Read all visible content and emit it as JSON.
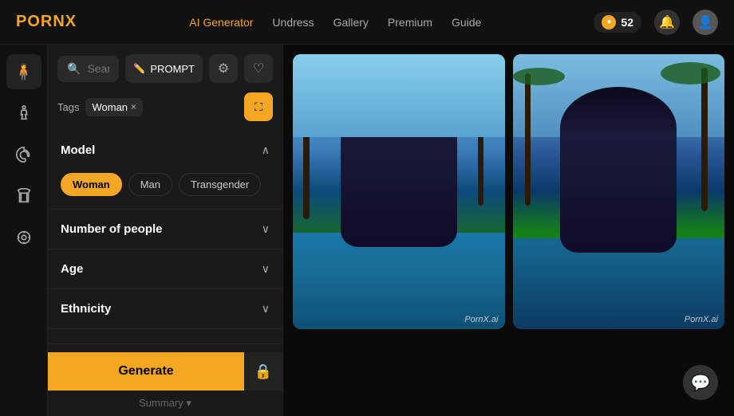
{
  "header": {
    "logo_prefix": "PORN",
    "logo_suffix": "X",
    "nav_items": [
      {
        "label": "AI Generator",
        "active": true
      },
      {
        "label": "Undress",
        "active": false
      },
      {
        "label": "Gallery",
        "active": false
      },
      {
        "label": "Premium",
        "active": false
      },
      {
        "label": "Guide",
        "active": false
      }
    ],
    "coins": "52",
    "bell_icon": "🔔",
    "user_icon": "👤"
  },
  "sidebar_icons": [
    {
      "icon": "🧍",
      "name": "model-icon",
      "active": true
    },
    {
      "icon": "🕺",
      "name": "pose-icon",
      "active": false
    },
    {
      "icon": "🎭",
      "name": "style-icon",
      "active": false
    },
    {
      "icon": "📦",
      "name": "outfit-icon",
      "active": false
    },
    {
      "icon": "⚙️",
      "name": "settings-icon",
      "active": false
    }
  ],
  "search": {
    "placeholder": "Search tags",
    "prompt_label": "PROMPT",
    "settings_icon": "⚙",
    "heart_icon": "♡"
  },
  "tags": {
    "label": "Tags",
    "active_tags": [
      {
        "text": "Woman",
        "removable": true
      }
    ],
    "expand_icon": "⛶"
  },
  "filters": {
    "model": {
      "title": "Model",
      "options": [
        {
          "label": "Woman",
          "selected": true
        },
        {
          "label": "Man",
          "selected": false
        },
        {
          "label": "Transgender",
          "selected": false
        }
      ]
    },
    "number_of_people": {
      "title": "Number of people",
      "options": []
    },
    "age": {
      "title": "Age",
      "options": []
    },
    "ethnicity": {
      "title": "Ethnicity",
      "options": []
    }
  },
  "generate": {
    "button_label": "Generate",
    "lock_icon": "🔒",
    "summary_label": "Summary ▾"
  },
  "images": [
    {
      "id": 1,
      "watermark": "PornX.ai",
      "scene": "left"
    },
    {
      "id": 2,
      "watermark": "PornX.ai",
      "scene": "right"
    }
  ],
  "chat": {
    "icon": "💬"
  }
}
